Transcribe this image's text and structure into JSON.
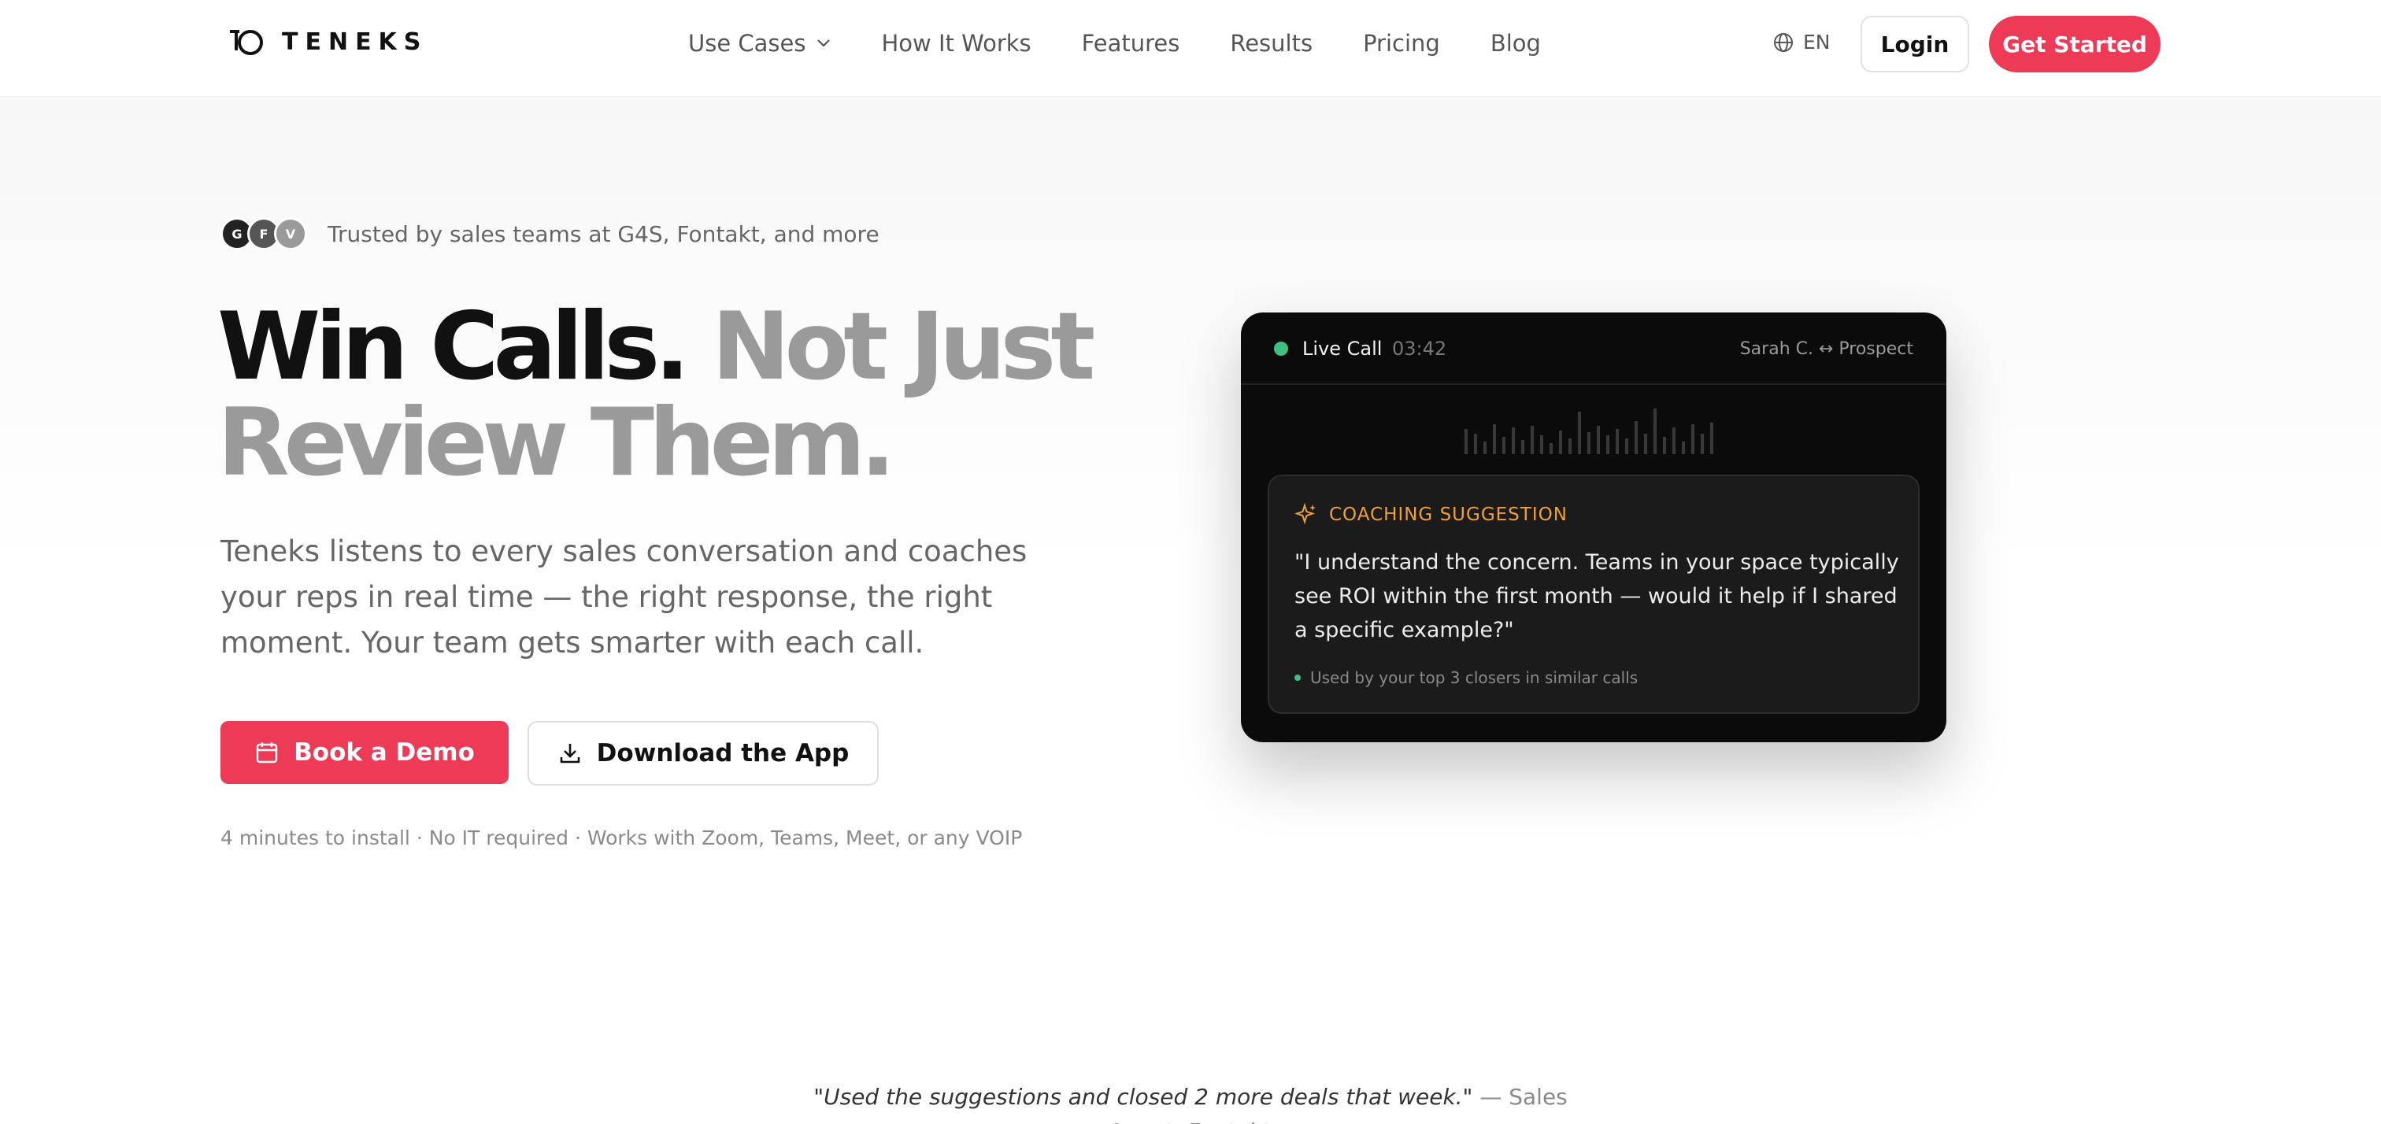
{
  "brand": {
    "name": "TENEKS"
  },
  "nav": {
    "items": [
      {
        "label": "Use Cases",
        "has_dropdown": true
      },
      {
        "label": "How It Works"
      },
      {
        "label": "Features"
      },
      {
        "label": "Results"
      },
      {
        "label": "Pricing"
      },
      {
        "label": "Blog"
      }
    ]
  },
  "header": {
    "language": "EN",
    "login_label": "Login",
    "cta_label": "Get Started"
  },
  "hero": {
    "avatars": [
      "G",
      "F",
      "V"
    ],
    "trusted_text": "Trusted by sales teams at G4S, Fontakt, and more",
    "headline_dark": "Win Calls.",
    "headline_gray_1": "Not Just",
    "headline_gray_2": "Review Them.",
    "subtext": "Teneks listens to every sales conversation and coaches your reps in real time — the right response, the right moment. Your team gets smarter with each call.",
    "demo_label": "Book a Demo",
    "download_label": "Download the App",
    "meta": "4 minutes to install · No IT required · Works with Zoom, Teams, Meet, or any VOIP"
  },
  "live_call": {
    "status_label": "Live Call",
    "duration": "03:42",
    "parties": "Sarah C. ↔ Prospect",
    "suggestion": {
      "title": "COACHING SUGGESTION",
      "quote": "\"I understand the concern. Teams in your space typically see ROI within the first month — would it help if I shared a specific example?\"",
      "note": "Used by your top 3 closers in similar calls"
    }
  },
  "testimonial": {
    "quote": "\"Used the suggestions and closed 2 more deals that week.\"",
    "attribution": " — Sales Agent, Fontakt"
  },
  "colors": {
    "accent": "#ec3a57",
    "live_green": "#3fbf7f",
    "suggestion_orange": "#f0a035",
    "card_bg": "#0b0b0b"
  },
  "icons": [
    "teneks-logo-icon",
    "chevron-down-icon",
    "globe-icon",
    "calendar-icon",
    "download-icon",
    "sparkle-icon"
  ]
}
